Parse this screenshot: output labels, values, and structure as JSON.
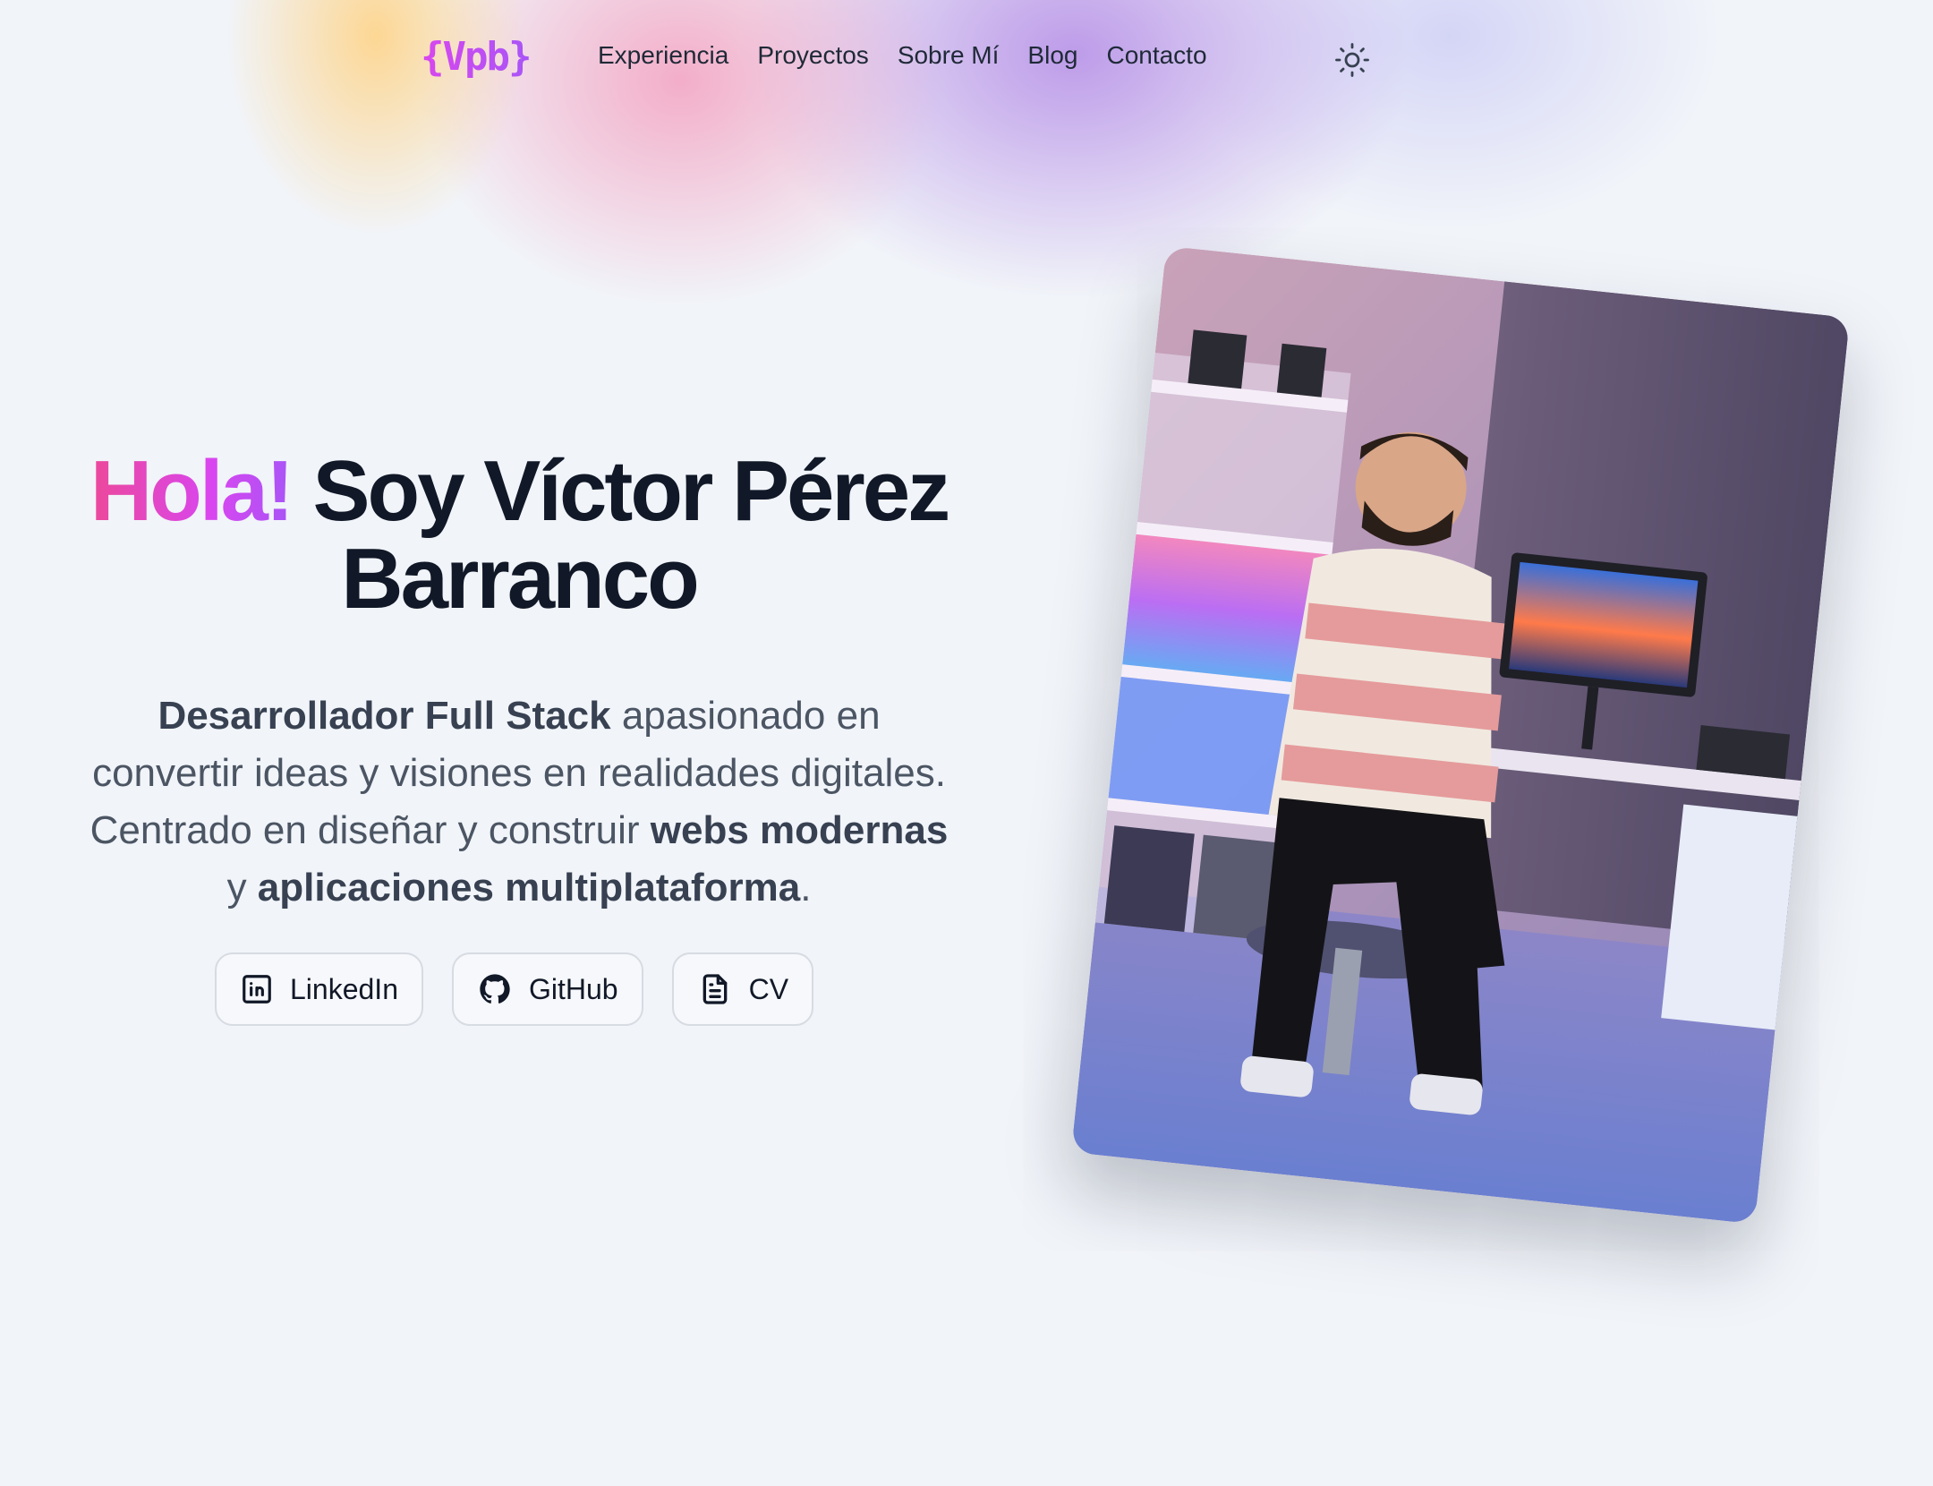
{
  "nav": {
    "logo": "{Vpb}",
    "links": [
      {
        "label": "Experiencia"
      },
      {
        "label": "Proyectos"
      },
      {
        "label": "Sobre Mí"
      },
      {
        "label": "Blog"
      },
      {
        "label": "Contacto"
      }
    ],
    "theme_icon": "sun-icon"
  },
  "hero": {
    "greeting": "Hola!",
    "name_line1": " Soy Víctor Pérez",
    "name_line2": "Barranco",
    "description": {
      "part1_bold": "Desarrollador Full Stack",
      "part2": " apasionado en convertir ideas y visiones en realidades digitales. Centrado en diseñar y construir ",
      "part3_bold": "webs modernas",
      "part4": " y ",
      "part5_bold": "aplicaciones multiplataforma",
      "part6": "."
    },
    "socials": [
      {
        "label": "LinkedIn",
        "icon": "linkedin-icon"
      },
      {
        "label": "GitHub",
        "icon": "github-icon"
      },
      {
        "label": "CV",
        "icon": "document-icon"
      }
    ]
  },
  "colors": {
    "accent_pink": "#ec4899",
    "accent_purple": "#a855f7",
    "background": "#f1f4f9",
    "text_dark": "#111827"
  }
}
